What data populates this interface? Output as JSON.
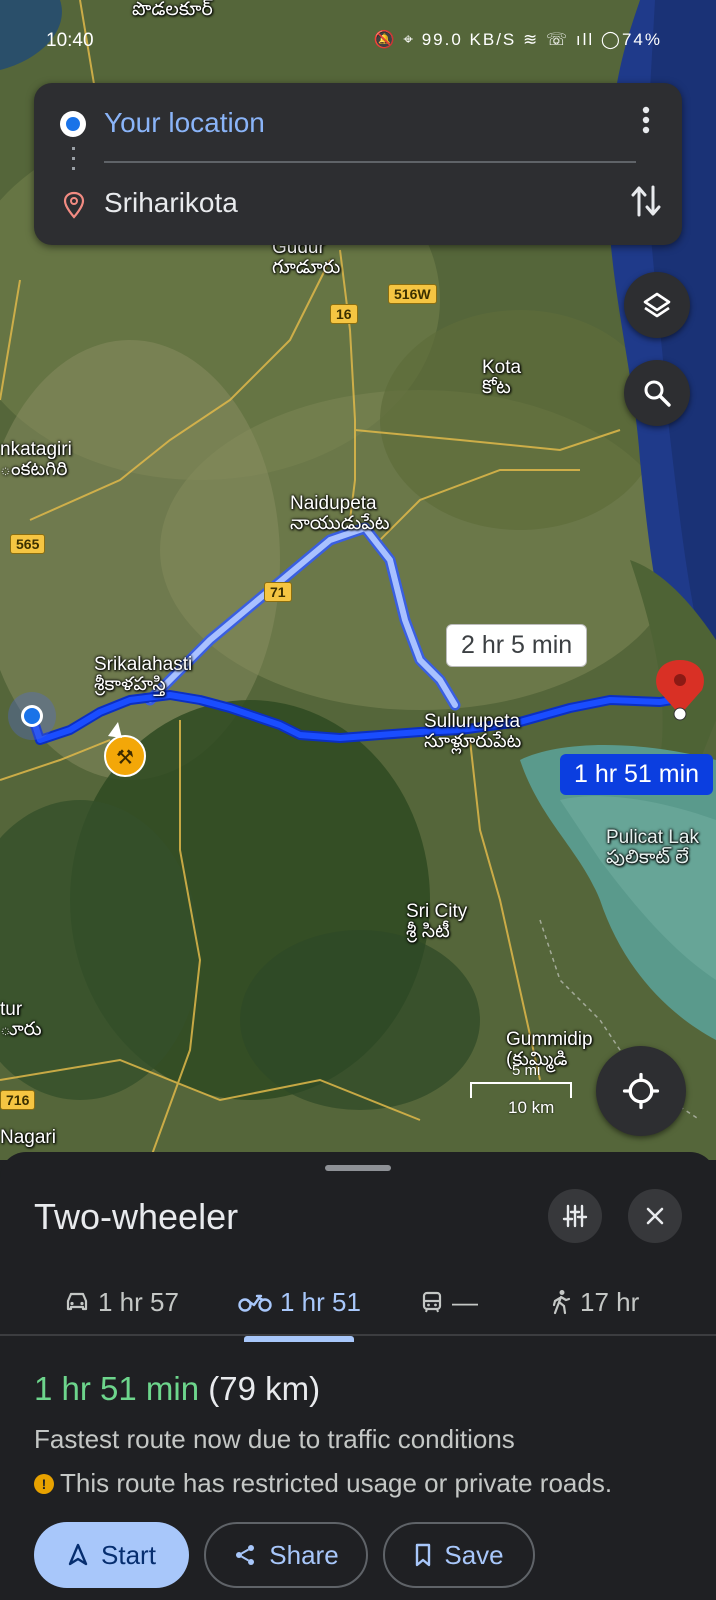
{
  "status_bar": {
    "time": "10:40",
    "icons": "🔕 ⌖ 99.0 KB/S ≋ ☏ ıll ◯",
    "battery": "74%"
  },
  "search": {
    "origin": "Your location",
    "destination": "Sriharikota"
  },
  "map": {
    "labels": [
      {
        "name": "Podalakur",
        "en": "",
        "te": "పొడలకూర్"
      },
      {
        "name": "Gudur",
        "en": "Gudur",
        "te": "గూడూరు"
      },
      {
        "name": "Kota",
        "en": "Kota",
        "te": "కోట"
      },
      {
        "name": "Venkatagiri",
        "en": "nkatagiri",
        "te": "ంకటగిరి"
      },
      {
        "name": "Naidupeta",
        "en": "Naidupeta",
        "te": "నాయుడుపేట"
      },
      {
        "name": "Srikalahasti",
        "en": "Srikalahasti",
        "te": "శ్రీకాళహస్తి"
      },
      {
        "name": "Sullurupeta",
        "en": "Sullurupeta",
        "te": "సూళ్లూరుపేట"
      },
      {
        "name": "Pulicat Lake",
        "en": "Pulicat Lak",
        "te": "పులికాట్ లే"
      },
      {
        "name": "Sri City",
        "en": "Sri City",
        "te": "శ్రీ సిటీ"
      },
      {
        "name": "Gummidipoondi",
        "en": "Gummidip",
        "te": "(కుమ్మిడి"
      },
      {
        "name": "Puttur",
        "en": "tur",
        "te": "ూరు"
      },
      {
        "name": "Nagari",
        "en": "Nagari",
        "te": ""
      }
    ],
    "shields": [
      "516W",
      "16",
      "565",
      "71",
      "716"
    ],
    "route_main_label": "1 hr 51 min",
    "route_alt_label": "2 hr 5 min",
    "scale": "10 km",
    "scale_alt": "5 mi"
  },
  "sheet": {
    "title": "Two-wheeler",
    "modes": [
      {
        "icon": "car-icon",
        "label": "1 hr 57"
      },
      {
        "icon": "motorcycle-icon",
        "label": "1 hr 51"
      },
      {
        "icon": "transit-icon",
        "label": "—"
      },
      {
        "icon": "walk-icon",
        "label": "17 hr"
      }
    ],
    "selected_mode": "Two-wheeler",
    "summary_duration": "1 hr 51 min",
    "summary_distance": "(79 km)",
    "note": "Fastest route now due to traffic conditions",
    "warning": "This route has restricted usage or private roads.",
    "buttons": {
      "start": "Start",
      "share": "Share",
      "save": "Save"
    }
  },
  "colors": {
    "route_main": "#0b3ee0",
    "route_alt": "#a9c1ff",
    "accent": "#a8c7fa",
    "duration_green": "#6dd58c"
  }
}
